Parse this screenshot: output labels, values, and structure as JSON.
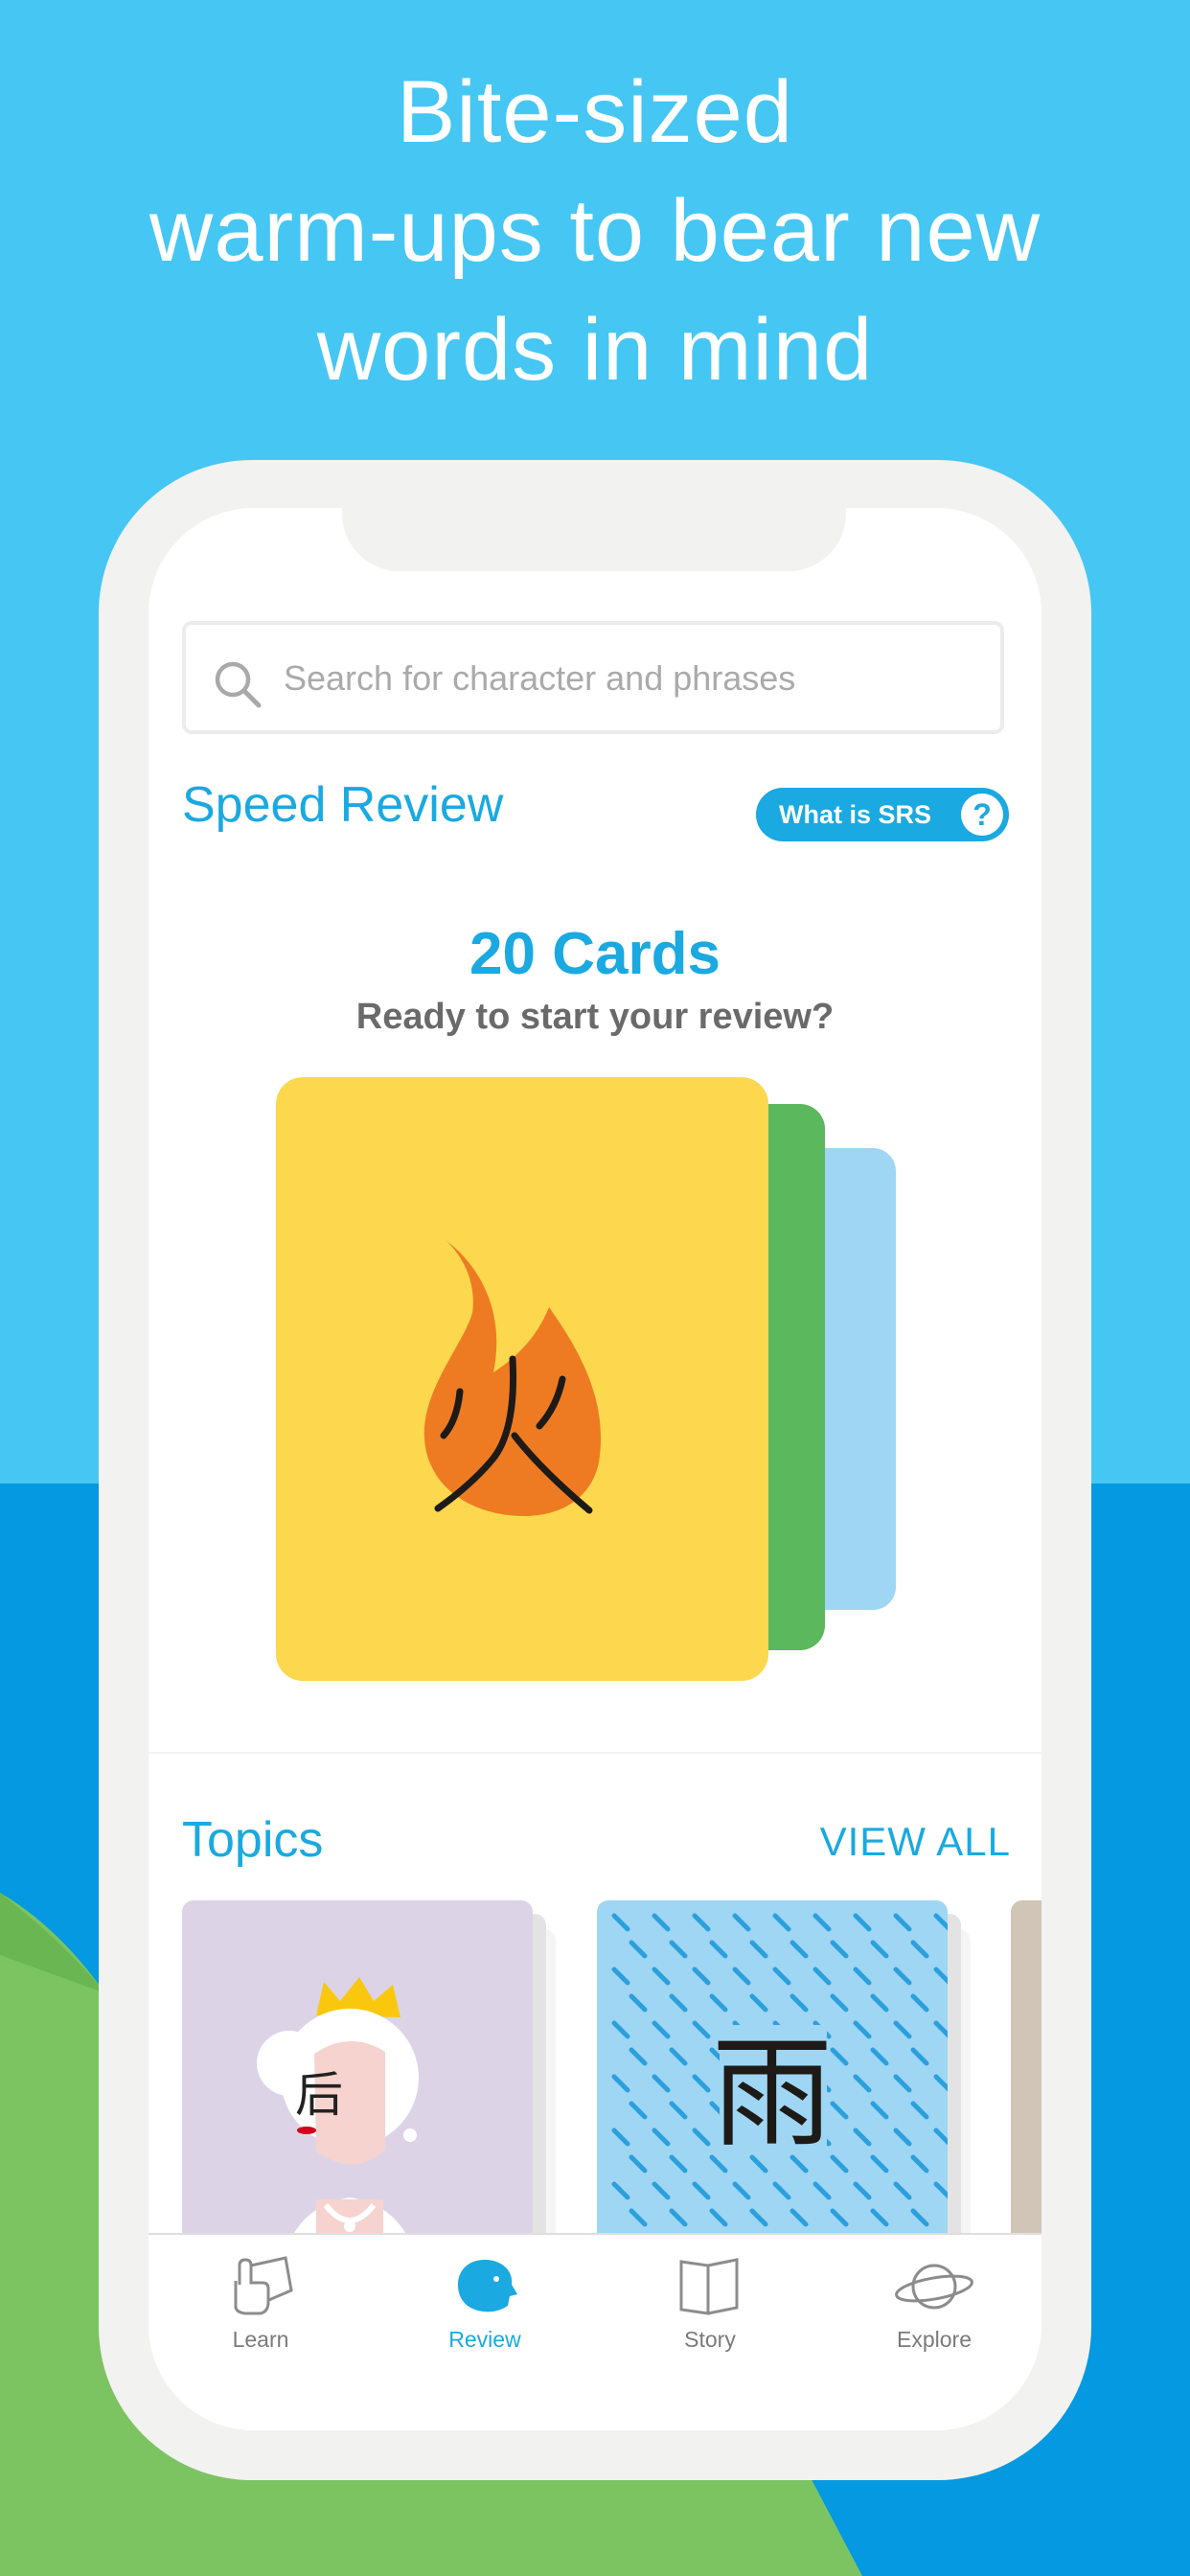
{
  "headline": {
    "line1": "Bite-sized",
    "line2": "warm-ups to bear new",
    "line3": "words in mind"
  },
  "search": {
    "placeholder": "Search for character and phrases"
  },
  "speed_review": {
    "title": "Speed Review",
    "srs_button_label": "What is SRS",
    "srs_help_glyph": "?",
    "cards_count": "20 Cards",
    "subtitle": "Ready to start your review?",
    "front_card_character": "火"
  },
  "topics": {
    "title": "Topics",
    "view_all": "VIEW ALL",
    "cards": [
      {
        "character": "后",
        "icon": "queen-icon",
        "color": "#ddd3e6"
      },
      {
        "character": "雨",
        "icon": "rain-icon",
        "color": "#9fd6f3"
      }
    ]
  },
  "tabs": [
    {
      "label": "Learn",
      "icon": "hand-card-icon",
      "active": false
    },
    {
      "label": "Review",
      "icon": "head-icon",
      "active": true
    },
    {
      "label": "Story",
      "icon": "book-icon",
      "active": false
    },
    {
      "label": "Explore",
      "icon": "planet-icon",
      "active": false
    }
  ],
  "colors": {
    "sky": "#46c6f3",
    "sea": "#0499e0",
    "grass": "#7cc462",
    "accent": "#1aa9e0",
    "card_yellow": "#fdd84e",
    "card_green": "#5cb85c",
    "card_blue": "#9fd6f3",
    "flame": "#ee7b22"
  }
}
